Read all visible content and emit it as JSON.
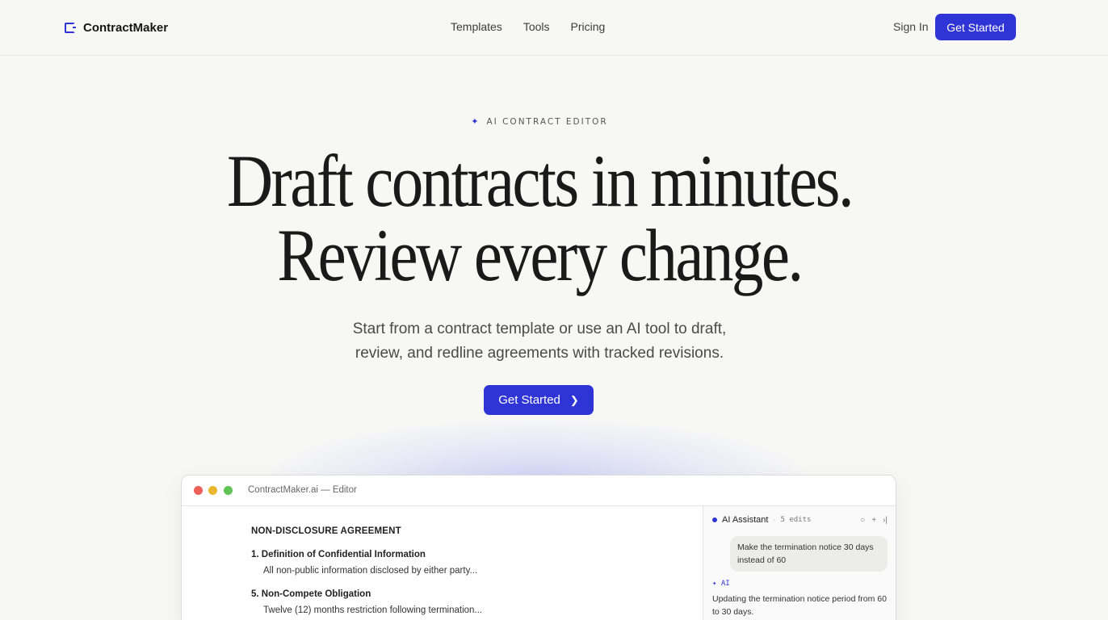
{
  "nav": {
    "brand": "ContractMaker",
    "links": [
      "Templates",
      "Tools",
      "Pricing"
    ],
    "sign_in": "Sign In",
    "cta": "Get Started"
  },
  "hero": {
    "eyebrow": "AI CONTRACT EDITOR",
    "eyebrow_icon": "sparkle-icon",
    "headline_line1": "Draft contracts in minutes.",
    "headline_line2": "Review every change.",
    "subhead_line1": "Start from a contract template or use an AI tool to draft,",
    "subhead_line2": "review, and redline agreements with tracked revisions.",
    "cta": "Get Started"
  },
  "editor": {
    "window_title": "ContractMaker.ai — Editor",
    "doc_title": "NON-DISCLOSURE AGREEMENT",
    "sections": [
      {
        "heading": "1. Definition of Confidential Information",
        "body": "All non-public information disclosed by either party..."
      },
      {
        "heading": "5. Non-Compete Obligation",
        "body": "Twelve (12) months restriction following termination..."
      }
    ],
    "assistant": {
      "name": "AI Assistant",
      "edits": "5 edits",
      "user_message": "Make the termination notice 30 days instead of 60",
      "ai_label": "✦ AI",
      "ai_reply": "Updating the termination notice period from 60 to 30 days."
    }
  },
  "colors": {
    "accent": "#2f34d6",
    "background": "#f7f7f6"
  }
}
